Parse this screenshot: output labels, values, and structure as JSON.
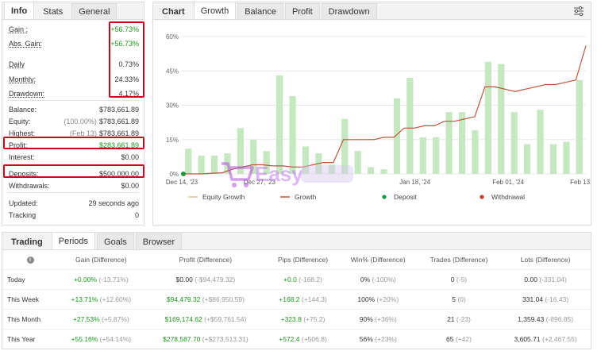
{
  "left_tabs": [
    "Info",
    "Stats",
    "General"
  ],
  "stats": [
    {
      "label": "Gain :",
      "value": "+56.73%",
      "green": true,
      "underline": true,
      "diff": ""
    },
    {
      "label": "Abs. Gain:",
      "value": "+56.73%",
      "green": true,
      "underline": true,
      "diff": ""
    },
    {
      "label": "Daily",
      "value": "0.73%",
      "green": false,
      "underline": true,
      "diff": ""
    },
    {
      "label": "Monthly:",
      "value": "24.33%",
      "green": false,
      "underline": true,
      "diff": ""
    },
    {
      "label": "Drawdown:",
      "value": "4.17%",
      "green": false,
      "underline": true,
      "diff": ""
    },
    {
      "label": "Balance:",
      "value": "$783,661.89",
      "green": false,
      "underline": false,
      "diff": ""
    },
    {
      "label": "Equity:",
      "value": "$783,661.89",
      "green": false,
      "underline": false,
      "diff": "(100.00%)"
    },
    {
      "label": "Highest:",
      "value": "$783,661.89",
      "green": false,
      "underline": false,
      "diff": "(Feb 13)"
    },
    {
      "label": "Profit:",
      "value": "$283,661.89",
      "green": true,
      "underline": false,
      "diff": ""
    },
    {
      "label": "Interest:",
      "value": "$0.00",
      "green": false,
      "underline": false,
      "diff": ""
    },
    {
      "label": "Deposits:",
      "value": "$500,000.00",
      "green": false,
      "underline": false,
      "diff": ""
    },
    {
      "label": "Withdrawals:",
      "value": "$0.00",
      "green": false,
      "underline": false,
      "diff": ""
    },
    {
      "label": "Updated:",
      "value": "29 seconds ago",
      "green": false,
      "underline": false,
      "diff": ""
    },
    {
      "label": "Tracking",
      "value": "0",
      "green": false,
      "underline": false,
      "diff": ""
    }
  ],
  "chart_tabs": [
    "Chart",
    "Growth",
    "Balance",
    "Profit",
    "Drawdown"
  ],
  "chart_data": {
    "type": "bar",
    "y_ticks": [
      "0%",
      "15%",
      "30%",
      "45%",
      "60%"
    ],
    "ylim": [
      0,
      60
    ],
    "x_tick_labels": [
      "Dec 14, '23",
      "Dec 27, '23",
      "Jan 18, '24",
      "Feb 01, '24",
      "Feb 13, '24"
    ],
    "x_tick_positions": [
      0,
      5,
      15,
      21,
      26
    ],
    "bar_count": 27,
    "series": [
      {
        "name": "Equity Growth",
        "type": "bar",
        "values": [
          11,
          8,
          8,
          9,
          20,
          15,
          10,
          43,
          34,
          12,
          9,
          4,
          24,
          10,
          3,
          2,
          33,
          42,
          16,
          16,
          27,
          27,
          19,
          49,
          48,
          27,
          13,
          28,
          13,
          14,
          41
        ]
      },
      {
        "name": "Growth",
        "type": "line",
        "values": [
          0,
          0,
          0,
          0.3,
          0.5,
          2,
          3,
          4,
          4,
          3.5,
          3.5,
          3,
          3,
          4,
          5,
          5,
          15,
          15,
          15,
          15,
          16,
          16,
          20,
          20,
          21,
          21,
          23,
          23,
          24,
          25,
          38,
          38,
          37,
          36,
          37,
          38,
          39,
          39,
          40,
          41,
          56
        ]
      },
      {
        "name": "Deposit",
        "type": "point",
        "values": [
          0
        ]
      },
      {
        "name": "Withdrawal",
        "type": "point",
        "values": []
      }
    ],
    "legend": [
      "Equity Growth",
      "Growth",
      "Deposit",
      "Withdrawal"
    ],
    "colors": {
      "bar": "#c5e8c0",
      "line": "#c0533a",
      "deposit": "#1a9a3a",
      "withdrawal": "#d23c2a",
      "legend_equity": "#e3c49a"
    }
  },
  "bottom_tabs": [
    "Trading",
    "Periods",
    "Goals",
    "Browser"
  ],
  "table": {
    "headers": [
      "",
      "Gain (Difference)",
      "Profit (Difference)",
      "Pips (Difference)",
      "Win% (Difference)",
      "Trades (Difference)",
      "Lots (Difference)"
    ],
    "rows": [
      {
        "label": "Today",
        "cells": [
          [
            "+0.00%",
            "(-13.71%)",
            true
          ],
          [
            "$0.00",
            "(-$94,479.32)",
            false
          ],
          [
            "+0.0",
            "(-168.2)",
            true
          ],
          [
            "0%",
            "(-100%)",
            false
          ],
          [
            "0",
            "(-5)",
            false
          ],
          [
            "0.00",
            "(-331.04)",
            false
          ]
        ]
      },
      {
        "label": "This Week",
        "cells": [
          [
            "+13.71%",
            "(+12.60%)",
            true
          ],
          [
            "$94,479.32",
            "(+$86,950.59)",
            true
          ],
          [
            "+168.2",
            "(+144.3)",
            true
          ],
          [
            "100%",
            "(+20%)",
            false
          ],
          [
            "5",
            "(0)",
            false
          ],
          [
            "331.04",
            "(-16.43)",
            false
          ]
        ]
      },
      {
        "label": "This Month",
        "cells": [
          [
            "+27.53%",
            "(+5.87%)",
            true
          ],
          [
            "$169,174.62",
            "(+$59,761.54)",
            true
          ],
          [
            "+323.8",
            "(+75.2)",
            true
          ],
          [
            "90%",
            "(+36%)",
            false
          ],
          [
            "21",
            "(-23)",
            false
          ],
          [
            "1,359.43",
            "(-896.85)",
            false
          ]
        ]
      },
      {
        "label": "This Year",
        "cells": [
          [
            "+55.16%",
            "(+54.14%)",
            true
          ],
          [
            "$278,587.70",
            "(+$273,513.31)",
            true
          ],
          [
            "+572.4",
            "(+506.8)",
            true
          ],
          [
            "56%",
            "(+23%)",
            false
          ],
          [
            "65",
            "(+42)",
            false
          ],
          [
            "3,605.71",
            "(+2,467.55)",
            false
          ]
        ]
      }
    ]
  },
  "watermark": {
    "text": "Easy"
  }
}
